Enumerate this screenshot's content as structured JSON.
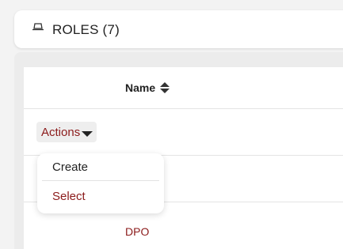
{
  "header": {
    "title": "ROLES (7)",
    "icon": "hat-icon"
  },
  "table": {
    "columns": [
      {
        "label": "Name",
        "sortable": true
      }
    ],
    "actions_label": "Actions",
    "rows": [
      {
        "name": "DPO"
      }
    ]
  },
  "dropdown": {
    "items": [
      {
        "label": "Create"
      },
      {
        "label": "Select"
      }
    ]
  },
  "colors": {
    "accent": "#8b1a1a",
    "background": "#f3f3f3",
    "card": "#ffffff"
  }
}
